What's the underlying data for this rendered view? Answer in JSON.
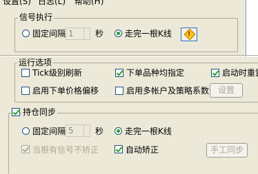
{
  "menubar": {
    "items": [
      "设置(S)",
      "日志(L)",
      "帮助(H)"
    ]
  },
  "signal_group": {
    "title": "信号执行",
    "fixed_interval_label": "固定间隔",
    "interval_value": "1",
    "seconds_label": "秒",
    "complete_bar_label": "走完一根K线",
    "fixed_selected": false,
    "complete_selected": true
  },
  "run_options": {
    "title": "运行选项",
    "tick_refresh": {
      "label": "Tick级别刷新",
      "checked": false
    },
    "order_type": {
      "label": "下单品种均指定",
      "checked": true
    },
    "auto_restart": {
      "label": "启动时重置",
      "checked": true
    },
    "price_offset": {
      "label": "启用下单价格偏移",
      "checked": false
    },
    "multi_account": {
      "label": "启用多帐户及策略系数",
      "checked": false
    },
    "settings_button": "设置"
  },
  "position_sync": {
    "title": "持仓同步",
    "enabled": true,
    "fixed_interval_label": "固定间隔",
    "interval_value": "5",
    "seconds_label": "秒",
    "complete_bar_label": "走完一根K线",
    "no_signal_label": "当根有信号不矫正",
    "no_signal_checked": true,
    "auto_correct_label": "自动矫正",
    "auto_correct_checked": true,
    "manual_sync_button": "手工同步"
  }
}
